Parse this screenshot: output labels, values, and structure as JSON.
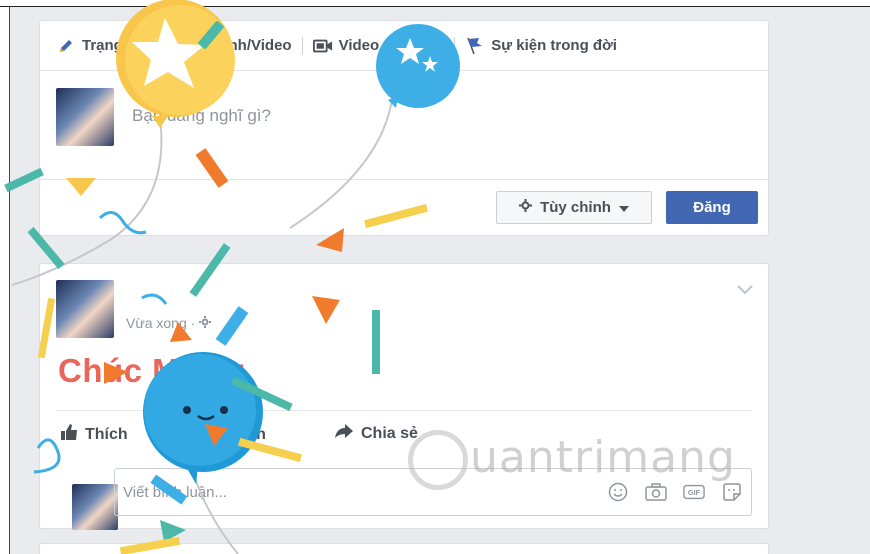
{
  "composer": {
    "tabs": [
      {
        "icon": "pencil-icon",
        "label": "Trạng thái"
      },
      {
        "icon": "photo-icon",
        "label": "Ảnh/Video"
      },
      {
        "icon": "video-camera-icon",
        "label": "Video trực tiếp"
      },
      {
        "icon": "flag-icon",
        "label": "Sự kiện trong đời"
      }
    ],
    "placeholder": "Bạn đang nghĩ gì?",
    "customize_label": "Tùy chỉnh",
    "post_label": "Đăng"
  },
  "post": {
    "time": "Vừa xong ·",
    "text": "Chúc Mừng",
    "actions": {
      "like": "Thích",
      "comment": "Bình luận",
      "share": "Chia sẻ"
    },
    "comment_placeholder": "Viết bình luận...",
    "comment_icons": [
      "emoji-icon",
      "camera-icon",
      "gif-icon",
      "sticker-icon"
    ],
    "gif_label": "GIF"
  },
  "watermark": "uantrimang",
  "colors": {
    "accent": "#4267b2",
    "celebration_text": "#e9665b"
  }
}
